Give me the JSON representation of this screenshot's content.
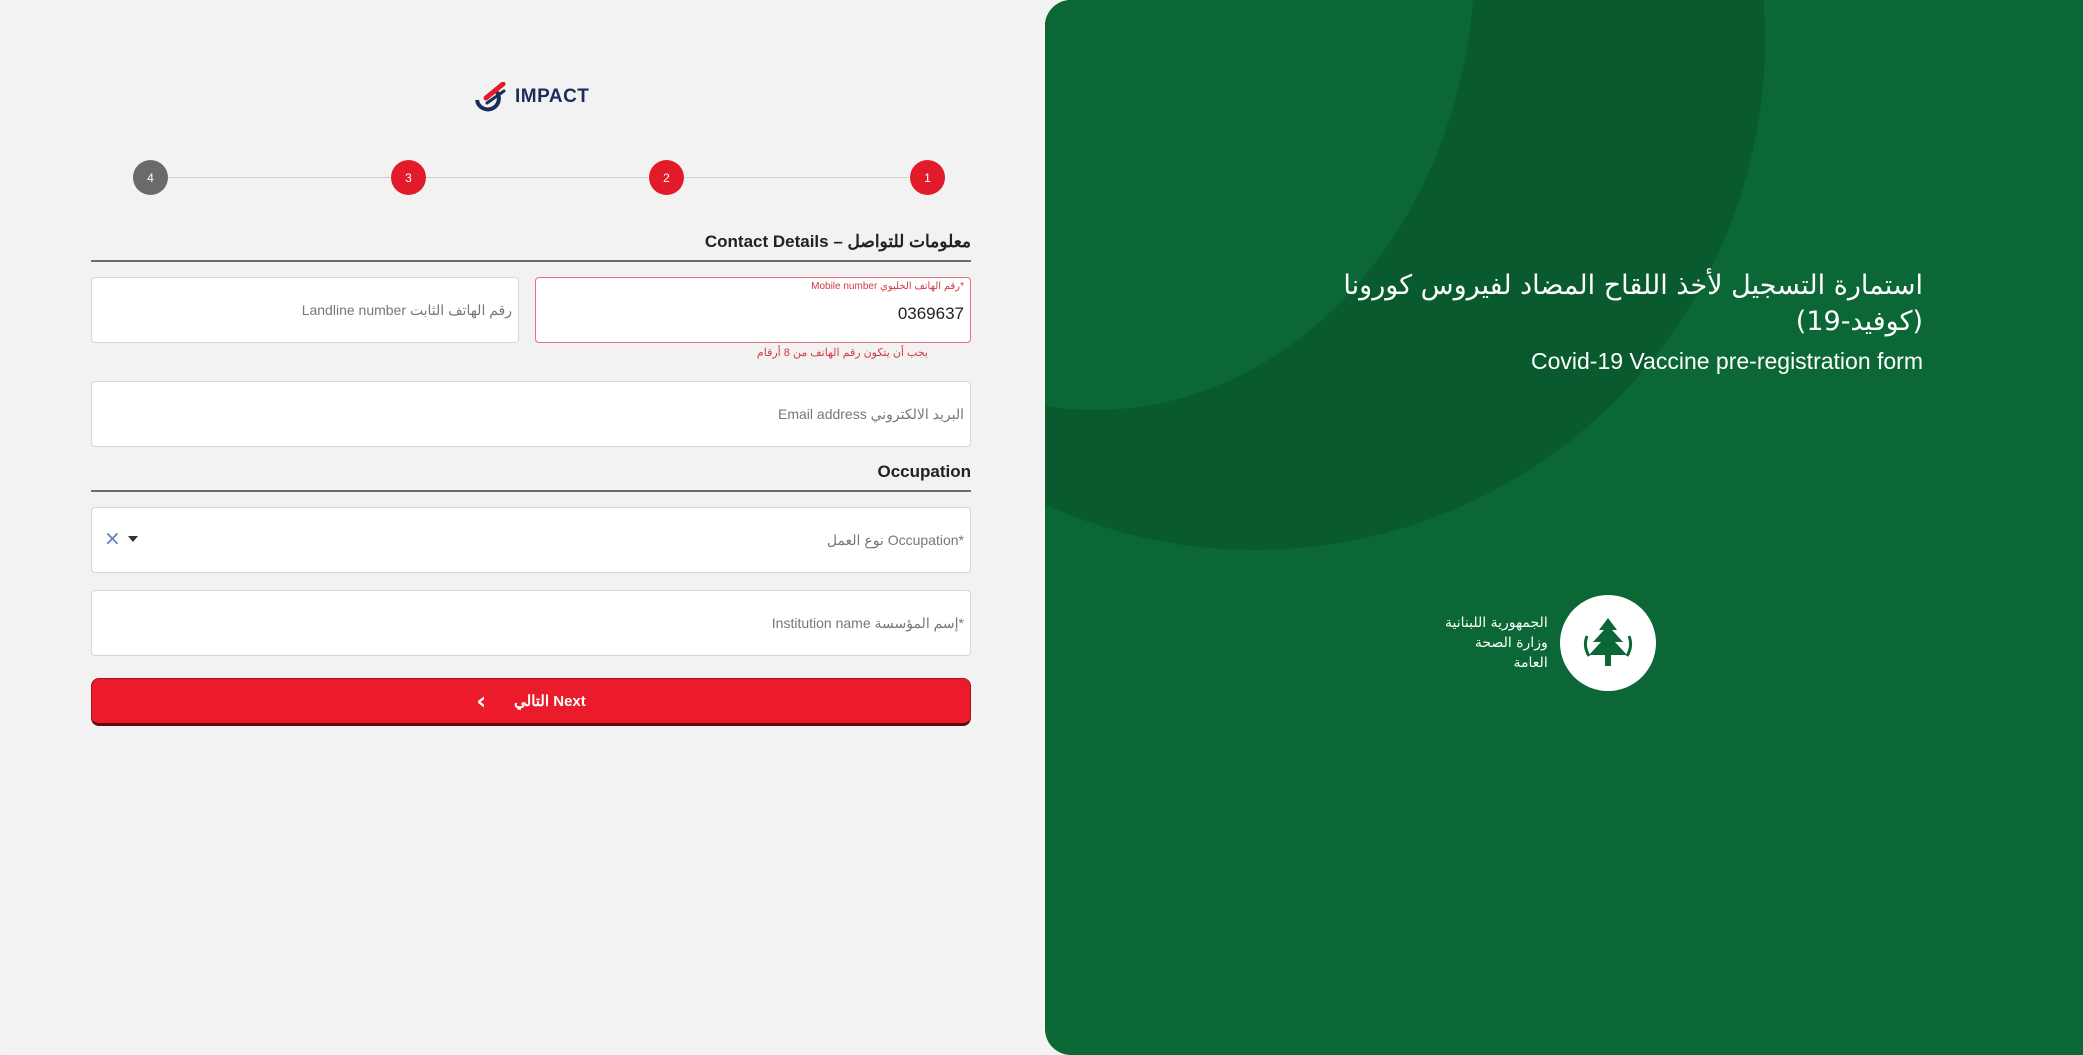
{
  "brand": {
    "name": "IMPACT"
  },
  "stepper": {
    "steps": [
      "1",
      "2",
      "3",
      "4"
    ]
  },
  "contact": {
    "section_title": "Contact Details – معلومات للتواصل",
    "mobile": {
      "label": "Mobile number رقم الهاتف الخليوي*",
      "value": "0369637",
      "error": "يجب أن يتكون رقم الهاتف من 8 أرقام"
    },
    "landline": {
      "placeholder": "Landline number رقم الهاتف الثابت"
    },
    "email": {
      "placeholder": "Email address البريد الالكتروني"
    }
  },
  "occupation": {
    "section_title": "Occupation",
    "type": {
      "placeholder": "نوع العمل Occupation*"
    },
    "institution": {
      "placeholder": "Institution name إسم المؤسسة*"
    }
  },
  "next_button": {
    "label": "التالي Next",
    "icon": "chevron-left-icon"
  },
  "hero": {
    "title_ar": "استمارة التسجيل لأخذ اللقاح المضاد لفيروس كورونا (كوفيد-19)",
    "title_en": "Covid-19 Vaccine pre-registration form"
  },
  "ministry": {
    "line1": "الجمهورية اللبنانية",
    "line2": "وزارة الصحة",
    "line3": "العامة"
  },
  "colors": {
    "accent_red": "#ec1b2c",
    "brand_green": "#0b6836",
    "step_inactive": "#6a6a6a"
  }
}
